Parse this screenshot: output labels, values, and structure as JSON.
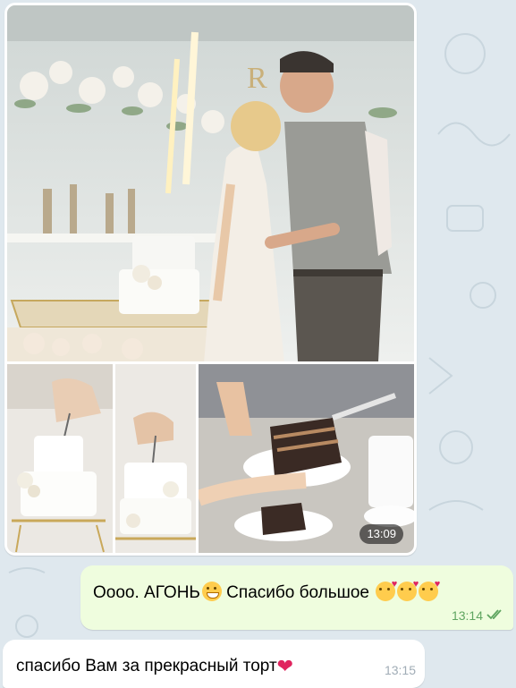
{
  "album": {
    "time": "13:09",
    "photos": [
      {
        "name": "kiss-with-cake-sparklers"
      },
      {
        "name": "cake-cutting-knife-1"
      },
      {
        "name": "cake-cutting-knife-2"
      },
      {
        "name": "cake-slice-plating"
      }
    ],
    "sign_text": "R"
  },
  "outgoing": {
    "text": "Оооо. АГОНЬ",
    "text2": " Спасибо большое ",
    "time": "13:14",
    "status": "read"
  },
  "incoming": {
    "text": "спасибо Вам за прекрасный торт",
    "time": "13:15"
  },
  "colors": {
    "chat_bg": "#dfe8ee",
    "outgoing_bubble": "#effdde",
    "read_check": "#5fa560"
  }
}
